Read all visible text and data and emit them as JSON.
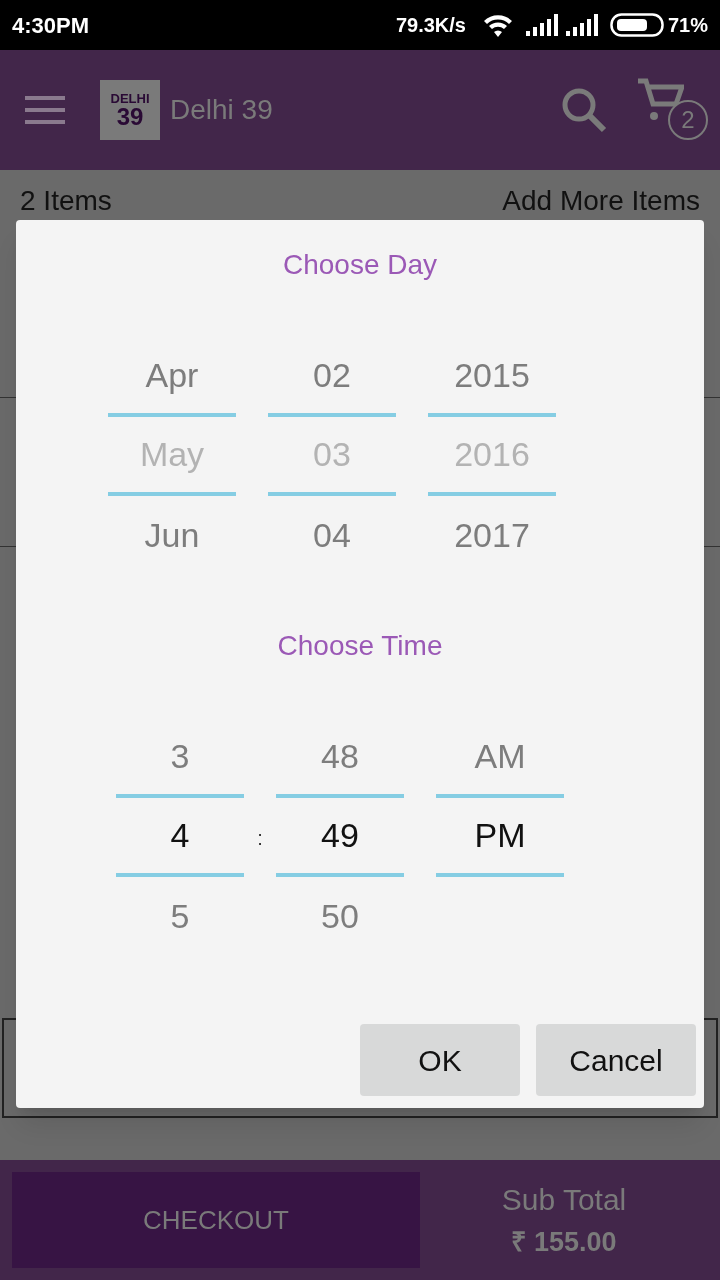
{
  "status_bar": {
    "time": "4:30PM",
    "speed": "79.3K/s",
    "battery": "71%"
  },
  "app_bar": {
    "logo_line_1": "DELHI",
    "logo_line_2": "39",
    "title": "Delhi 39",
    "cart_count": "2"
  },
  "cart": {
    "items_count": "2 Items",
    "add_more": "Add More Items"
  },
  "dialog": {
    "day_title": "Choose Day",
    "time_title": "Choose Time",
    "day_picker": {
      "disabled": true,
      "columns": [
        {
          "items": [
            {
              "text": "Apr",
              "selected": false
            },
            {
              "text": "May",
              "selected": true
            },
            {
              "text": "Jun",
              "selected": false
            }
          ]
        },
        {
          "items": [
            {
              "text": "02",
              "selected": false
            },
            {
              "text": "03",
              "selected": true
            },
            {
              "text": "04",
              "selected": false
            }
          ]
        },
        {
          "items": [
            {
              "text": "2015",
              "selected": false
            },
            {
              "text": "2016",
              "selected": true
            },
            {
              "text": "2017",
              "selected": false
            }
          ]
        }
      ]
    },
    "time_picker": {
      "disabled": false,
      "separator": ":",
      "columns": [
        {
          "items": [
            {
              "text": "3",
              "selected": false
            },
            {
              "text": "4",
              "selected": true
            },
            {
              "text": "5",
              "selected": false
            }
          ]
        },
        {
          "items": [
            {
              "text": "48",
              "selected": false
            },
            {
              "text": "49",
              "selected": true
            },
            {
              "text": "50",
              "selected": false
            }
          ]
        },
        {
          "items": [
            {
              "text": "AM",
              "selected": false
            },
            {
              "text": "PM",
              "selected": true
            }
          ]
        }
      ]
    },
    "buttons": [
      "OK",
      "Cancel"
    ]
  },
  "bottom_bar": {
    "checkout": "CHECKOUT",
    "subtotal_label": "Sub Total",
    "subtotal": "₹ 155.00"
  }
}
